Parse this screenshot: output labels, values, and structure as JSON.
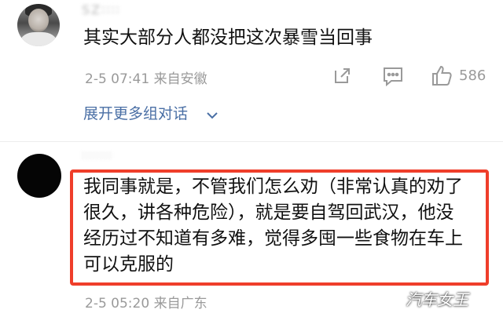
{
  "comments": [
    {
      "username": "SZ∶∶∶∶",
      "text": "其实大部分人都没把这次暴雪当回事",
      "time": "2-5 07:41",
      "location": "来自安徽",
      "likes": "586",
      "expand_label": "展开更多组对话"
    },
    {
      "username": "∶∶∶∶∶∶∶",
      "text_lines": [
        "我同事就是，不管我们怎么劝（非常认真的劝了",
        "很久，讲各种危险），就是要自驾回武汉，他没",
        "经历过不知道有多难，觉得多囤一些食物在车上",
        "可以克服的"
      ],
      "time": "2-5 05:20",
      "location": "来自广东"
    }
  ],
  "watermark": "汽车女王",
  "colors": {
    "highlight_border": "#ef3e2a",
    "link_blue": "#4a6fa5",
    "meta_gray": "#9a9a9a"
  },
  "icons": [
    "share-icon",
    "reply-icon",
    "like-icon",
    "chevron-down-icon"
  ]
}
